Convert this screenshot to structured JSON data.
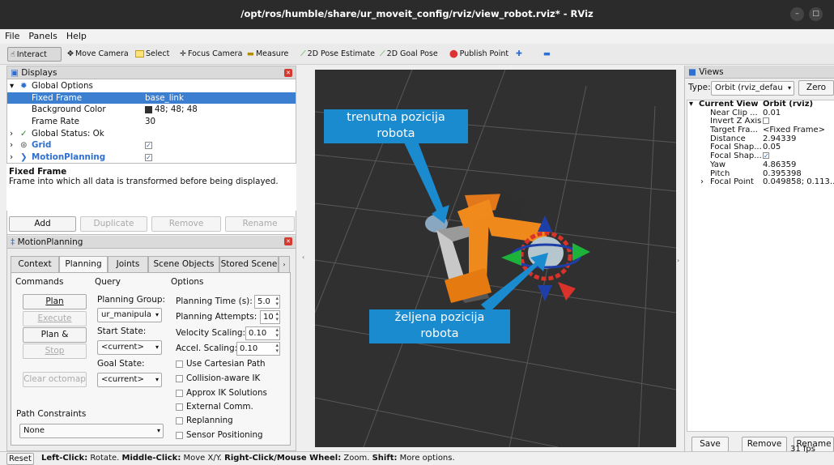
{
  "window": {
    "title": "/opt/ros/humble/share/ur_moveit_config/rviz/view_robot.rviz* - RViz",
    "min_symbol": "–",
    "max_symbol": "□"
  },
  "menu": [
    "File",
    "Panels",
    "Help"
  ],
  "toolbar": {
    "interact": "Interact",
    "move_camera": "Move Camera",
    "select": "Select",
    "focus_camera": "Focus Camera",
    "measure": "Measure",
    "pose_estimate": "2D Pose Estimate",
    "goal_pose": "2D Goal Pose",
    "publish_point": "Publish Point"
  },
  "displays": {
    "title": "Displays",
    "items": [
      {
        "label": "Global Options",
        "value": ""
      },
      {
        "label": "Fixed Frame",
        "value": "base_link"
      },
      {
        "label": "Background Color",
        "value": "48; 48; 48"
      },
      {
        "label": "Frame Rate",
        "value": "30"
      },
      {
        "label": "Global Status: Ok",
        "value": ""
      },
      {
        "label": "Grid",
        "value": "✓"
      },
      {
        "label": "MotionPlanning",
        "value": "✓"
      }
    ],
    "description_title": "Fixed Frame",
    "description_text": "Frame into which all data is transformed before being displayed.",
    "buttons": {
      "add": "Add",
      "duplicate": "Duplicate",
      "remove": "Remove",
      "rename": "Rename"
    }
  },
  "motion": {
    "title": "MotionPlanning",
    "tabs": [
      "Context",
      "Planning",
      "Joints",
      "Scene Objects",
      "Stored Scene"
    ],
    "commands_label": "Commands",
    "query_label": "Query",
    "options_label": "Options",
    "buttons": {
      "plan": "Plan",
      "execute": "Execute",
      "plan_execute": "Plan & Execute",
      "stop": "Stop",
      "clear_octomap": "Clear octomap"
    },
    "planning_group_label": "Planning Group:",
    "planning_group": "ur_manipula",
    "start_state_label": "Start State:",
    "start_state": "<current>",
    "goal_state_label": "Goal State:",
    "goal_state": "<current>",
    "planning_time_label": "Planning Time (s):",
    "planning_time": "5.0",
    "planning_attempts_label": "Planning Attempts:",
    "planning_attempts": "10",
    "velocity_label": "Velocity Scaling:",
    "velocity": "0.10",
    "accel_label": "Accel. Scaling:",
    "accel": "0.10",
    "checkboxes": [
      "Use Cartesian Path",
      "Collision-aware IK",
      "Approx IK Solutions",
      "External Comm.",
      "Replanning",
      "Sensor Positioning"
    ],
    "path_constraints_label": "Path Constraints",
    "path_constraints": "None"
  },
  "viewport": {
    "callout_current": [
      "trenutna pozicija",
      "robota"
    ],
    "callout_goal": [
      "željena pozicija",
      "robota"
    ]
  },
  "views": {
    "title": "Views",
    "type_label": "Type:",
    "type_value": "Orbit (rviz_defau",
    "zero": "Zero",
    "rows": [
      {
        "k": "Current View",
        "v": "Orbit (rviz)"
      },
      {
        "k": "Near Clip ...",
        "v": "0.01"
      },
      {
        "k": "Invert Z Axis",
        "v": ""
      },
      {
        "k": "Target Fra...",
        "v": "<Fixed Frame>"
      },
      {
        "k": "Distance",
        "v": "2.94339"
      },
      {
        "k": "Focal Shap...",
        "v": "0.05"
      },
      {
        "k": "Focal Shap...",
        "v": "✓"
      },
      {
        "k": "Yaw",
        "v": "4.86359"
      },
      {
        "k": "Pitch",
        "v": "0.395398"
      },
      {
        "k": "Focal Point",
        "v": "0.049858; 0.113..."
      }
    ],
    "buttons": {
      "save": "Save",
      "remove": "Remove",
      "rename": "Rename"
    }
  },
  "status": {
    "reset": "Reset",
    "left_click": "Left-Click:",
    "left_text": " Rotate. ",
    "middle_click": "Middle-Click:",
    "middle_text": " Move X/Y. ",
    "right_click": "Right-Click/Mouse Wheel:",
    "right_text": " Zoom. ",
    "shift": "Shift:",
    "shift_text": " More options.",
    "fps": "31 fps"
  }
}
